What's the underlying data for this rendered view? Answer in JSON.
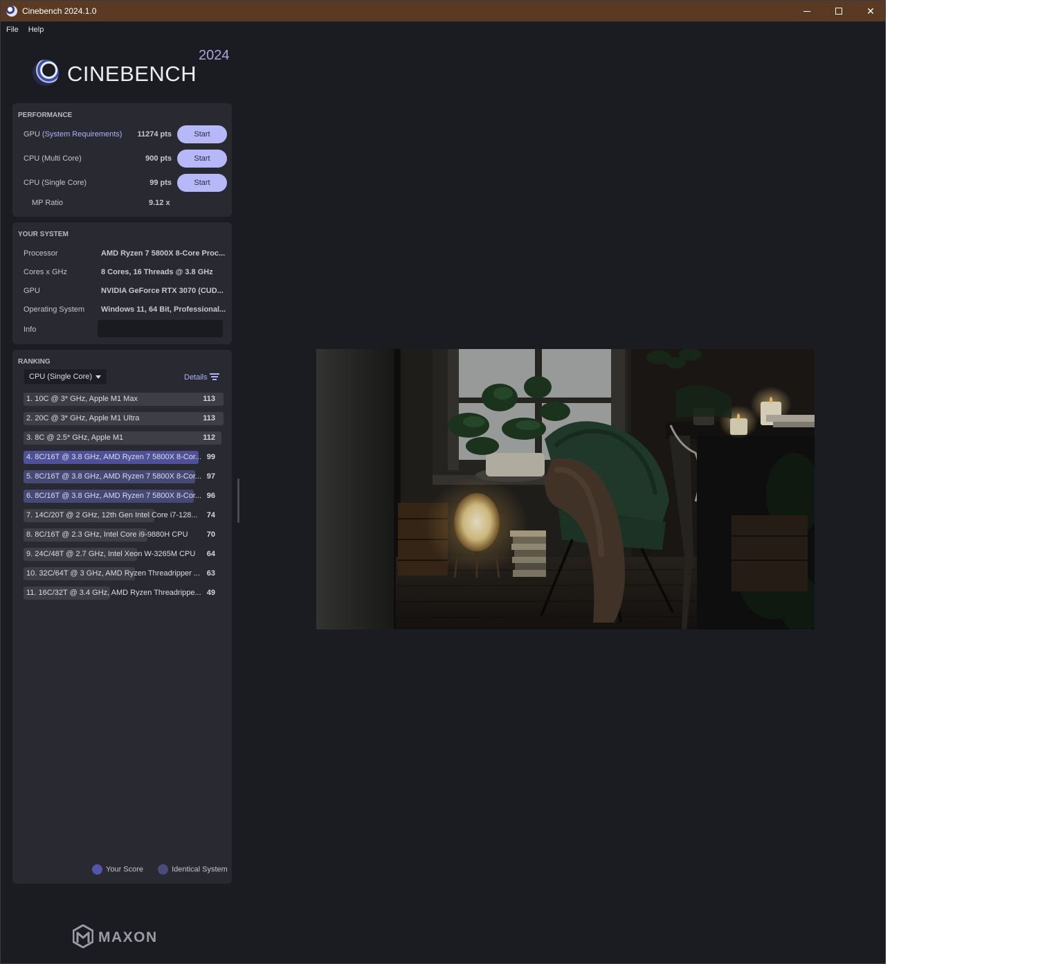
{
  "window": {
    "title": "Cinebench 2024.1.0"
  },
  "menu": {
    "file": "File",
    "help": "Help"
  },
  "logo": {
    "name": "CINEBENCH",
    "year": "2024",
    "vendor": "MAXON"
  },
  "performance": {
    "title": "PERFORMANCE",
    "gpu": {
      "label": "GPU",
      "link": "(System Requirements)",
      "score": "11274 pts",
      "button": "Start"
    },
    "cpu_multi": {
      "label": "CPU (Multi Core)",
      "score": "900 pts",
      "button": "Start"
    },
    "cpu_single": {
      "label": "CPU (Single Core)",
      "score": "99 pts",
      "button": "Start"
    },
    "mp_ratio": {
      "label": "MP Ratio",
      "value": "9.12 x"
    }
  },
  "system": {
    "title": "YOUR SYSTEM",
    "rows": [
      {
        "label": "Processor",
        "value": "AMD Ryzen 7 5800X 8-Core Proc..."
      },
      {
        "label": "Cores x GHz",
        "value": "8 Cores, 16 Threads @ 3.8 GHz"
      },
      {
        "label": "GPU",
        "value": "NVIDIA GeForce RTX 3070 (CUD..."
      },
      {
        "label": "Operating System",
        "value": "Windows 11, 64 Bit, Professional..."
      }
    ],
    "info_label": "Info"
  },
  "ranking": {
    "title": "RANKING",
    "selected_test": "CPU (Single Core)",
    "details": "Details",
    "max_score": 113,
    "items": [
      {
        "label": "1. 10C @ 3* GHz, Apple M1 Max",
        "score": "113",
        "value": 113,
        "kind": "other"
      },
      {
        "label": "2. 20C @ 3* GHz, Apple M1 Ultra",
        "score": "113",
        "value": 113,
        "kind": "other"
      },
      {
        "label": "3. 8C @ 2.5* GHz, Apple M1",
        "score": "112",
        "value": 112,
        "kind": "other"
      },
      {
        "label": "4. 8C/16T @ 3.8 GHz, AMD Ryzen 7 5800X 8-Cor...",
        "score": "99",
        "value": 99,
        "kind": "mine"
      },
      {
        "label": "5. 8C/16T @ 3.8 GHz, AMD Ryzen 7 5800X 8-Cor...",
        "score": "97",
        "value": 97,
        "kind": "ident"
      },
      {
        "label": "6. 8C/16T @ 3.8 GHz, AMD Ryzen 7 5800X 8-Cor...",
        "score": "96",
        "value": 96,
        "kind": "ident"
      },
      {
        "label": "7. 14C/20T @ 2 GHz, 12th Gen Intel Core i7-128...",
        "score": "74",
        "value": 74,
        "kind": "other"
      },
      {
        "label": "8. 8C/16T @ 2.3 GHz, Intel Core i9-9880H CPU",
        "score": "70",
        "value": 70,
        "kind": "other"
      },
      {
        "label": "9. 24C/48T @ 2.7 GHz, Intel Xeon W-3265M CPU",
        "score": "64",
        "value": 64,
        "kind": "other"
      },
      {
        "label": "10. 32C/64T @ 3 GHz, AMD Ryzen Threadripper ...",
        "score": "63",
        "value": 63,
        "kind": "other"
      },
      {
        "label": "11. 16C/32T @ 3.4 GHz, AMD Ryzen Threadrippe...",
        "score": "49",
        "value": 49,
        "kind": "other"
      }
    ],
    "legend": {
      "your_score": "Your Score",
      "identical": "Identical System"
    }
  },
  "colors": {
    "accent": "#b7b8f7",
    "your_score": "#5355a8",
    "identical": "#494b7a",
    "titlebar": "#5a3a22"
  },
  "icons": {
    "minimize": "minimize-icon",
    "maximize": "maximize-icon",
    "close": "close-icon",
    "details_filter": "filter-icon",
    "dropdown": "chevron-down-icon"
  }
}
